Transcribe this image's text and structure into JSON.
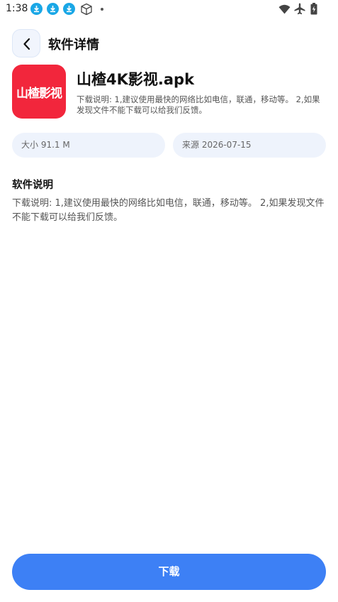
{
  "status_bar": {
    "time": "1:38",
    "notification_icons": [
      "download-icon",
      "download-icon",
      "download-icon",
      "box-icon",
      "dot-icon"
    ],
    "system_icons": [
      "wifi-icon",
      "airplane-icon",
      "battery-icon"
    ]
  },
  "header": {
    "back_icon": "chevron-left-icon",
    "title": "软件详情"
  },
  "app": {
    "icon_text": "山楂影视",
    "icon_color": "#f2263c",
    "name": "山楂4K影视.apk",
    "short_description": "下载说明: 1,建议使用最快的网络比如电信，联通，移动等。 2,如果发现文件不能下载可以给我们反馈。"
  },
  "info": {
    "size": "大小 91.1 M",
    "source": "来源 2026-07-15"
  },
  "description_section": {
    "title": "软件说明",
    "body": "下载说明: 1,建议使用最快的网络比如电信，联通，移动等。 2,如果发现文件不能下载可以给我们反馈。"
  },
  "actions": {
    "download_label": "下载",
    "accent_color": "#3d80f5"
  }
}
